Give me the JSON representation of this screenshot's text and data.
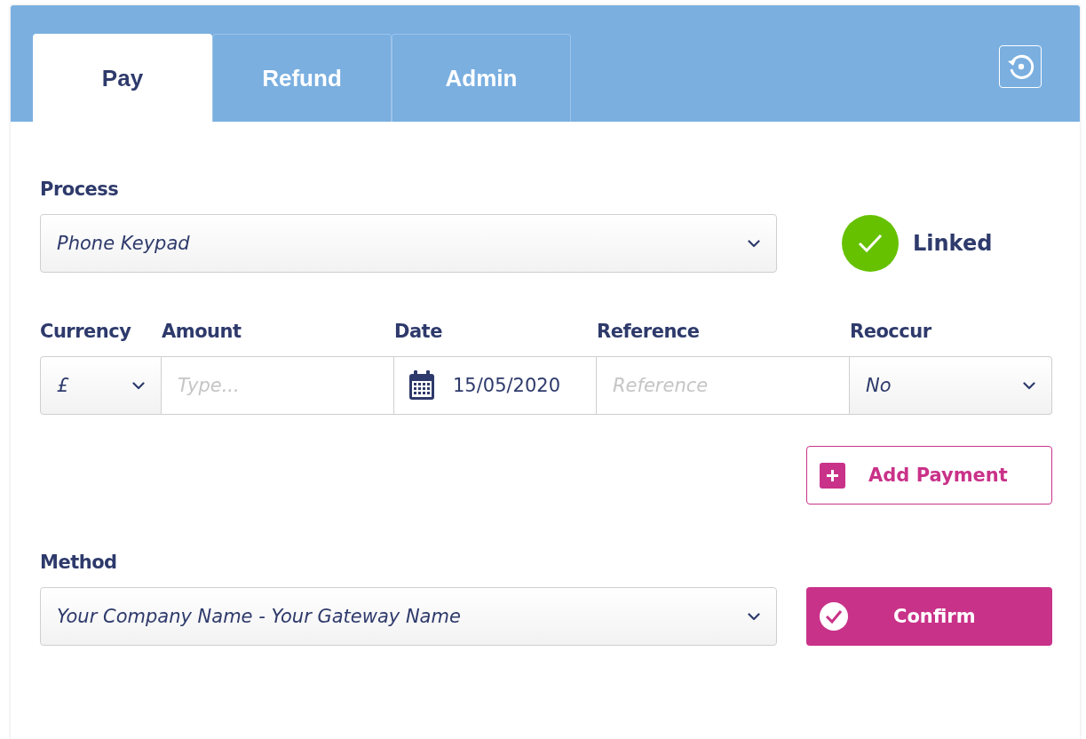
{
  "tabs": [
    {
      "label": "Pay",
      "selected": true
    },
    {
      "label": "Refund",
      "selected": false
    },
    {
      "label": "Admin",
      "selected": false
    }
  ],
  "process": {
    "label": "Process",
    "value": "Phone Keypad"
  },
  "link_status": {
    "label": "Linked",
    "linked": true
  },
  "fields": [
    {
      "kind": "select",
      "label": "Currency",
      "value": "£"
    },
    {
      "kind": "input",
      "label": "Amount",
      "placeholder": "Type..."
    },
    {
      "kind": "date",
      "label": "Date",
      "value": "15/05/2020"
    },
    {
      "kind": "input",
      "label": "Reference",
      "placeholder": "Reference"
    },
    {
      "kind": "select",
      "label": "Reoccur",
      "value": "No"
    }
  ],
  "add_button": "Add Payment",
  "method": {
    "label": "Method",
    "value": "Your Company Name - Your Gateway Name"
  },
  "confirm_button": "Confirm"
}
